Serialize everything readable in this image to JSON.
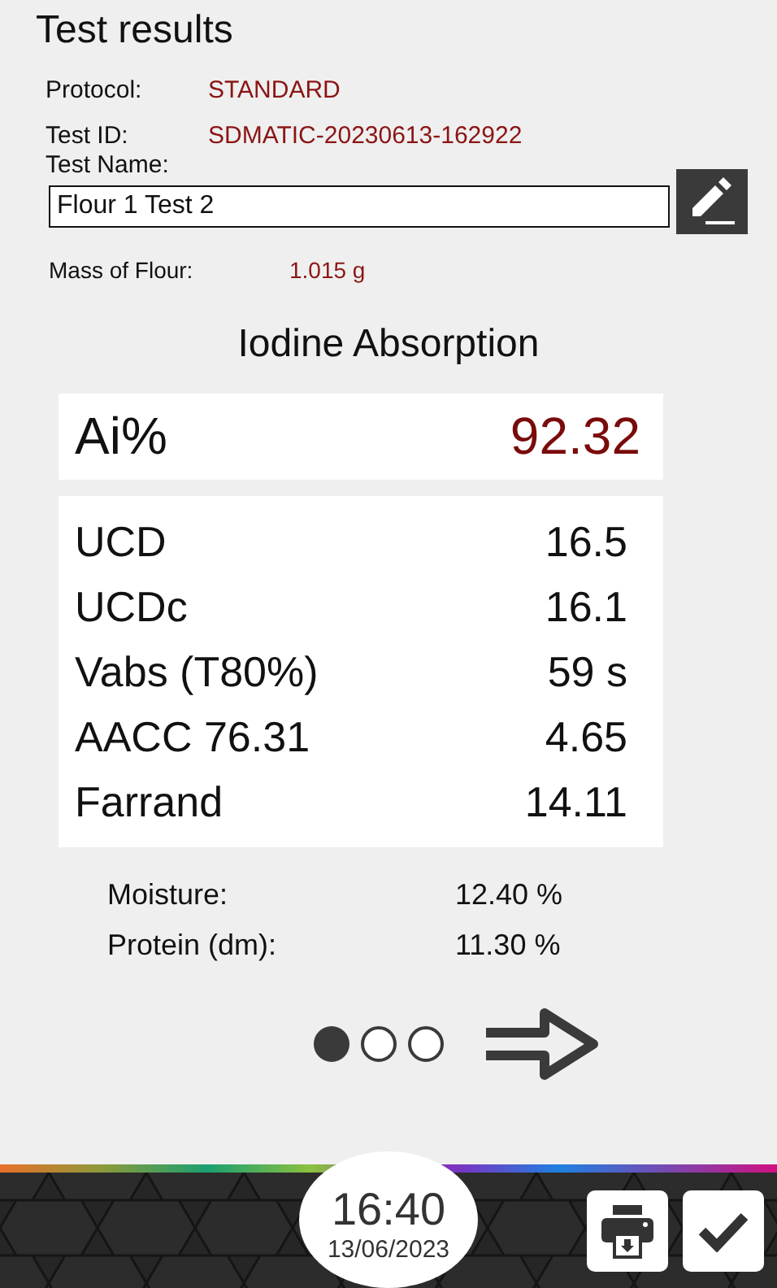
{
  "title": "Test results",
  "info": [
    {
      "label": "Protocol:",
      "value": "STANDARD"
    },
    {
      "label": "Test ID:",
      "value": "SDMATIC-20230613-162922"
    }
  ],
  "test_name": {
    "label": "Test Name:",
    "value": "Flour 1 Test 2"
  },
  "mass": {
    "label": "Mass of Flour:",
    "value": "1.015 g"
  },
  "section_title": "Iodine Absorption",
  "main_result": {
    "label": "Ai%",
    "value": "92.32"
  },
  "results": [
    {
      "label": "UCD",
      "value": "16.5"
    },
    {
      "label": "UCDc",
      "value": "16.1"
    },
    {
      "label": "Vabs (T80%)",
      "value": "59 s"
    },
    {
      "label": "AACC 76.31",
      "value": "4.65"
    },
    {
      "label": "Farrand",
      "value": "14.11"
    }
  ],
  "extras": [
    {
      "label": "Moisture:",
      "value": "12.40 %"
    },
    {
      "label": "Protein (dm):",
      "value": "11.30 %"
    }
  ],
  "pages": [
    {
      "selected": true
    },
    {
      "selected": false
    },
    {
      "selected": false
    }
  ],
  "clock": {
    "time": "16:40",
    "date": "13/06/2023"
  }
}
